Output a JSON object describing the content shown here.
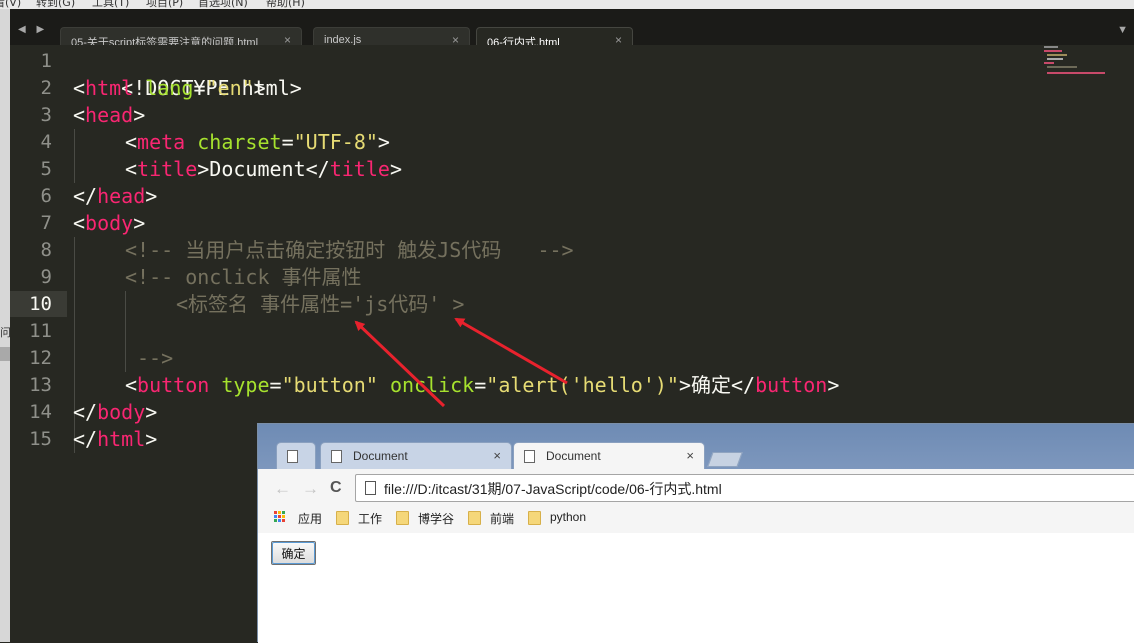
{
  "menubar": {
    "items": [
      "看(V)",
      "转到(G)",
      "工具(T)",
      "项目(P)",
      "首选项(N)",
      "帮助(H)"
    ]
  },
  "left_panel": {
    "glyph": "问"
  },
  "editor": {
    "tabs": [
      {
        "label": "05-关于script标签需要注意的问题.html",
        "close": "×"
      },
      {
        "label": "index.js",
        "close": "×"
      },
      {
        "label": "06-行内式.html",
        "close": "×"
      }
    ],
    "nav": "◀ ▶",
    "dropdown": "▼",
    "line_numbers": [
      "1",
      "2",
      "3",
      "4",
      "5",
      "6",
      "7",
      "8",
      "9",
      "10",
      "11",
      "12",
      "13",
      "14",
      "15"
    ],
    "current_line": "10",
    "colors": {
      "tag": "#f92672",
      "attr": "#a6e22e",
      "string": "#e6db74",
      "comment": "#75715e",
      "arrow": "#e8222d"
    },
    "code": {
      "l1": {
        "p1": "<!DOCTYPE html>"
      },
      "l2": {
        "p1": "<",
        "p2": "html",
        "p3": " ",
        "p4": "lang",
        "p5": "=",
        "p6": "\"en\"",
        "p7": ">"
      },
      "l3": {
        "p1": "<",
        "p2": "head",
        "p3": ">"
      },
      "l4": {
        "p1": "<",
        "p2": "meta",
        "p3": " ",
        "p4": "charset",
        "p5": "=",
        "p6": "\"UTF-8\"",
        "p7": ">"
      },
      "l5": {
        "p1": "<",
        "p2": "title",
        "p3": ">Document</",
        "p4": "title",
        "p5": ">"
      },
      "l6": {
        "p1": "</",
        "p2": "head",
        "p3": ">"
      },
      "l7": {
        "p1": "<",
        "p2": "body",
        "p3": ">"
      },
      "l8": {
        "p1": "<!-- 当用户点击确定按钮时 触发JS代码   -->"
      },
      "l9": {
        "p1": "<!-- onclick 事件属性"
      },
      "l10": {
        "p1": "<标签名 事件属性='js代码' >"
      },
      "l12": {
        "p1": "-->"
      },
      "l13": {
        "p1": "<",
        "p2": "button",
        "p3": " ",
        "p4": "type",
        "p5": "=",
        "p6": "\"button\"",
        "p7": " ",
        "p8": "onclick",
        "p9": "=",
        "p10": "\"alert('hello')\"",
        "p11": ">确定</",
        "p12": "button",
        "p13": ">"
      },
      "l14": {
        "p1": "</",
        "p2": "body",
        "p3": ">"
      },
      "l15": {
        "p1": "</",
        "p2": "html",
        "p3": ">"
      }
    }
  },
  "browser": {
    "tabs": [
      {
        "label": "",
        "pinned": true
      },
      {
        "label": "Document",
        "close": "×"
      },
      {
        "label": "Document",
        "close": "×"
      }
    ],
    "url": "file:///D:/itcast/31期/07-JavaScript/code/06-行内式.html",
    "nav": {
      "back": "←",
      "forward": "→",
      "reload": "C"
    },
    "bookmarks": [
      "应用",
      "工作",
      "博学谷",
      "前端",
      "python"
    ],
    "page": {
      "button_label": "确定"
    }
  }
}
